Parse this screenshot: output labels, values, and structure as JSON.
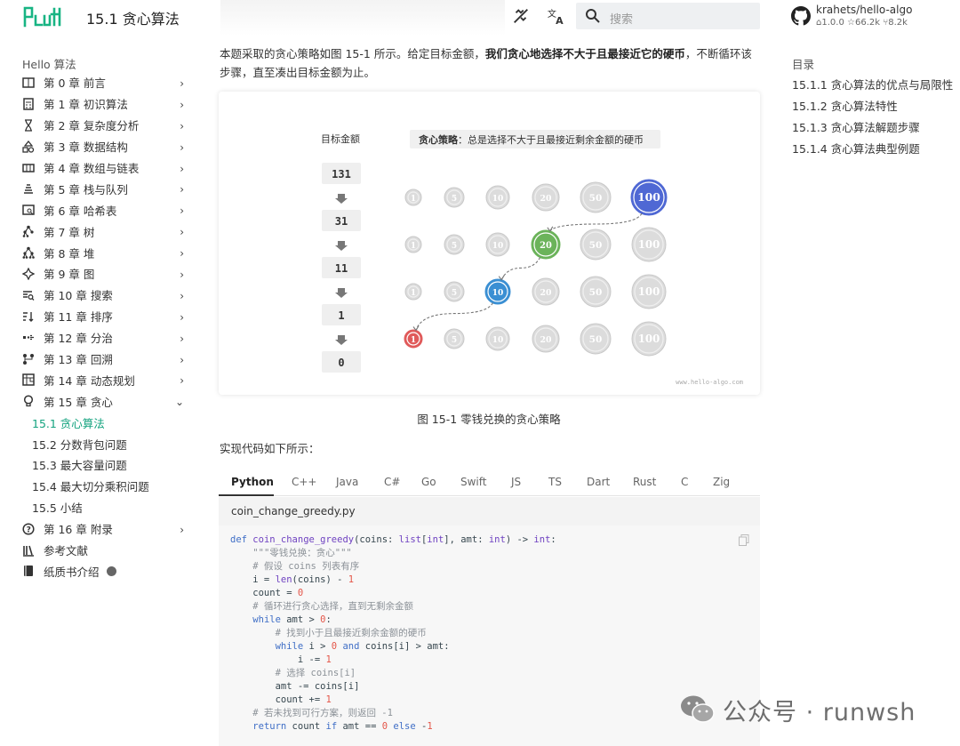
{
  "header": {
    "logo_text": "Hello",
    "title": "15.1  贪心算法",
    "search_placeholder": "搜索"
  },
  "repo": {
    "name": "krahets/hello-algo",
    "version": "1.0.0",
    "stars": "66.2k",
    "forks": "8.2k"
  },
  "sidebar": {
    "title": "Hello 算法",
    "items": [
      {
        "label": "第 0 章  前言",
        "icon": "book-icon"
      },
      {
        "label": "第 1 章  初识算法",
        "icon": "calculator-icon"
      },
      {
        "label": "第 2 章  复杂度分析",
        "icon": "hourglass-icon"
      },
      {
        "label": "第 3 章  数据结构",
        "icon": "shapes-icon"
      },
      {
        "label": "第 4 章  数组与链表",
        "icon": "array-icon"
      },
      {
        "label": "第 5 章  栈与队列",
        "icon": "stack-icon"
      },
      {
        "label": "第 6 章  哈希表",
        "icon": "hash-icon"
      },
      {
        "label": "第 7 章  树",
        "icon": "tree-icon"
      },
      {
        "label": "第 8 章  堆",
        "icon": "heap-icon"
      },
      {
        "label": "第 9 章  图",
        "icon": "graph-icon"
      },
      {
        "label": "第 10 章  搜索",
        "icon": "search-list-icon"
      },
      {
        "label": "第 11 章  排序",
        "icon": "sort-icon"
      },
      {
        "label": "第 12 章  分治",
        "icon": "divide-icon"
      },
      {
        "label": "第 13 章  回溯",
        "icon": "backtrack-icon"
      },
      {
        "label": "第 14 章  动态规划",
        "icon": "grid-icon"
      },
      {
        "label": "第 15 章  贪心",
        "icon": "lightbulb-icon"
      }
    ],
    "sub_items": [
      "15.1  贪心算法",
      "15.2  分数背包问题",
      "15.3  最大容量问题",
      "15.4  最大切分乘积问题",
      "15.5  小结"
    ],
    "bottom_items": [
      {
        "label": "第 16 章  附录",
        "icon": "help-circle-icon"
      },
      {
        "label": "参考文献",
        "icon": "library-icon"
      },
      {
        "label": "纸质书介绍",
        "icon": "book-closed-icon"
      }
    ]
  },
  "content": {
    "intro_1": "本题采取的贪心策略如图 15-1 所示。给定目标金额，",
    "intro_bold": "我们贪心地选择不大于且最接近它的硬币",
    "intro_2": "，不断循环该步骤，直至凑出目标金额为止。",
    "figure_caption": "图 15-1   零钱兑换的贪心策略",
    "code_intro": "实现代码如下所示：",
    "tabs": [
      "Python",
      "C++",
      "Java",
      "C#",
      "Go",
      "Swift",
      "JS",
      "TS",
      "Dart",
      "Rust",
      "C",
      "Zig"
    ],
    "active_tab": "Python",
    "file_name": "coin_change_greedy.py"
  },
  "figure": {
    "left_label": "目标金额",
    "strategy_bold": "贪心策略",
    "strategy_text": "：总是选择不大于且最接近剩余金额的硬币",
    "amounts": [
      "131",
      "31",
      "11",
      "1",
      "0"
    ],
    "coins": [
      "1",
      "5",
      "10",
      "20",
      "50",
      "100"
    ],
    "selected": [
      "100",
      "20",
      "10",
      "1"
    ],
    "colors": {
      "100": "#4f68d4",
      "20": "#6bb35a",
      "10": "#3a8fd3",
      "1": "#e05a5a",
      "inactive": "#cfcfcf"
    },
    "watermark": "www.hello-algo.com"
  },
  "toc": {
    "title": "目录",
    "items": [
      "15.1.1  贪心算法的优点与局限性",
      "15.1.2  贪心算法特性",
      "15.1.3  贪心算法解题步骤",
      "15.1.4  贪心算法典型例题"
    ]
  },
  "watermark": {
    "text": "公众号 · runwsh"
  }
}
